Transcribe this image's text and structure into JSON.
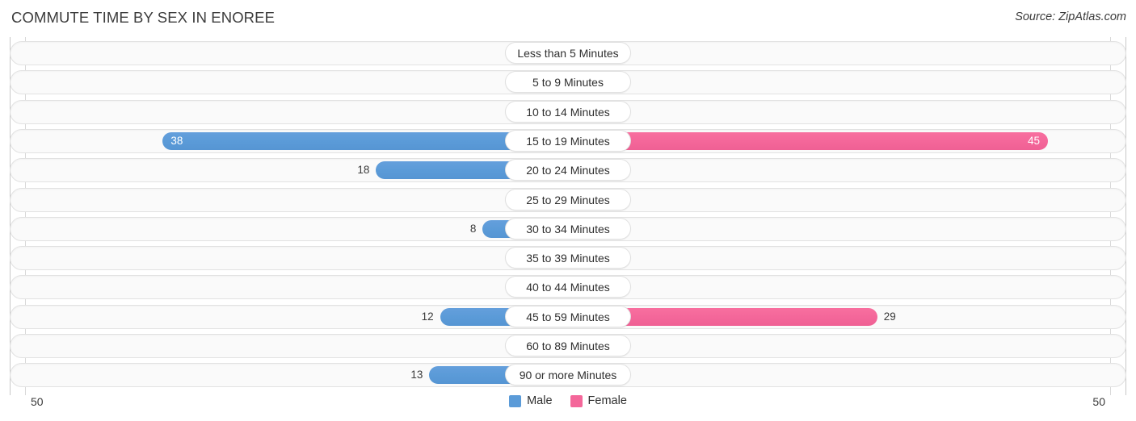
{
  "header": {
    "title": "COMMUTE TIME BY SEX IN ENOREE",
    "source": "Source: ZipAtlas.com"
  },
  "legend": {
    "items": [
      {
        "label": "Male",
        "color": "#5b9bd8"
      },
      {
        "label": "Female",
        "color": "#f4679a"
      }
    ]
  },
  "axis": {
    "left_max": "50",
    "right_max": "50"
  },
  "chart_data": {
    "type": "bar",
    "title": "COMMUTE TIME BY SEX IN ENOREE",
    "orientation": "horizontal-diverging",
    "xlabel": "",
    "ylabel": "",
    "xlim": [
      50,
      50
    ],
    "grid": true,
    "legend_position": "bottom-center",
    "categories": [
      "Less than 5 Minutes",
      "5 to 9 Minutes",
      "10 to 14 Minutes",
      "15 to 19 Minutes",
      "20 to 24 Minutes",
      "25 to 29 Minutes",
      "30 to 34 Minutes",
      "35 to 39 Minutes",
      "40 to 44 Minutes",
      "45 to 59 Minutes",
      "60 to 89 Minutes",
      "90 or more Minutes"
    ],
    "series": [
      {
        "name": "Male",
        "color": "#5b9bd8",
        "values": [
          0,
          0,
          0,
          38,
          18,
          0,
          8,
          0,
          0,
          12,
          0,
          13
        ]
      },
      {
        "name": "Female",
        "color": "#f4679a",
        "values": [
          0,
          0,
          0,
          45,
          0,
          0,
          0,
          0,
          0,
          29,
          0,
          0
        ]
      }
    ]
  }
}
